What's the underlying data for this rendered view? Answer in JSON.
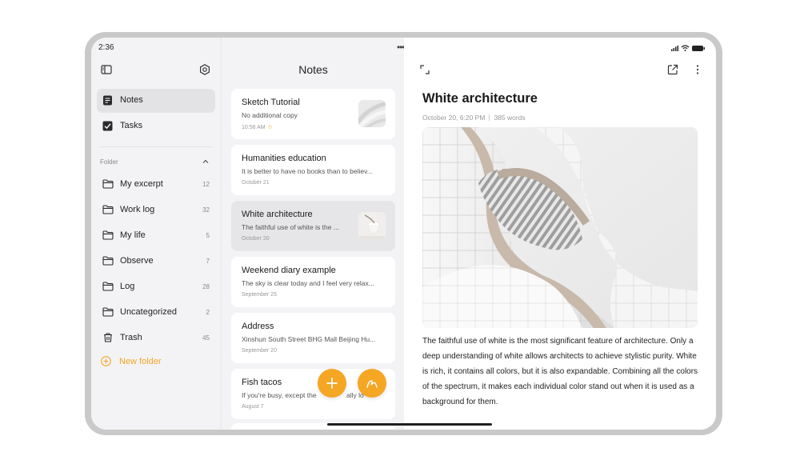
{
  "status": {
    "time": "2:36"
  },
  "sidebar": {
    "nav": [
      {
        "label": "Notes",
        "icon": "notes-icon",
        "active": true
      },
      {
        "label": "Tasks",
        "icon": "tasks-checkbox-icon",
        "active": false
      }
    ],
    "folder_header": "Folder",
    "folders": [
      {
        "label": "My excerpt",
        "count": "12"
      },
      {
        "label": "Work log",
        "count": "32"
      },
      {
        "label": "My life",
        "count": "5"
      },
      {
        "label": "Observe",
        "count": "7"
      },
      {
        "label": "Log",
        "count": "28"
      },
      {
        "label": "Uncategorized",
        "count": "2"
      },
      {
        "label": "Trash",
        "count": "45"
      }
    ],
    "new_folder_label": "New folder"
  },
  "list": {
    "title": "Notes",
    "notes": [
      {
        "title": "Sketch Tutorial",
        "preview": "No additional copy",
        "date": "10:56 AM",
        "pinned": true,
        "has_thumb": true
      },
      {
        "title": "Humanities education",
        "preview": "It is better to have no books than to believ...",
        "date": "October 21",
        "pinned": false,
        "has_thumb": false
      },
      {
        "title": "White architecture",
        "preview": "The faithful use of white is the ...",
        "date": "October 20",
        "pinned": false,
        "has_thumb": true,
        "selected": true
      },
      {
        "title": "Weekend diary example",
        "preview": "The sky is clear today and I feel very relax...",
        "date": "September 25",
        "pinned": false,
        "has_thumb": false
      },
      {
        "title": "Address",
        "preview": "Xinshun South Street BHG Mall Beijing Hu...",
        "date": "September 20",
        "pinned": false,
        "has_thumb": false
      },
      {
        "title": "Fish tacos",
        "preview": "If you're busy, except the",
        "preview_tail": "ally lo",
        "date": "August 7",
        "pinned": false,
        "has_thumb": false
      }
    ],
    "fab_add_icon": "plus-icon",
    "fab_draw_icon": "handwriting-icon"
  },
  "detail": {
    "title": "White architecture",
    "date": "October 20, 6:20 PM",
    "words": "385 words",
    "body": "The faithful use of white is the most significant feature of architecture. Only a deep understanding of white allows architects to achieve stylistic purity. White is rich, it contains all colors, but it is also expandable. Combining all the colors of the spectrum, it makes each individual color stand out when it is used as a background for them."
  },
  "colors": {
    "accent": "#f5a623",
    "sidebar_bg": "#f3f3f5",
    "selected_card": "#e6e6e8"
  }
}
